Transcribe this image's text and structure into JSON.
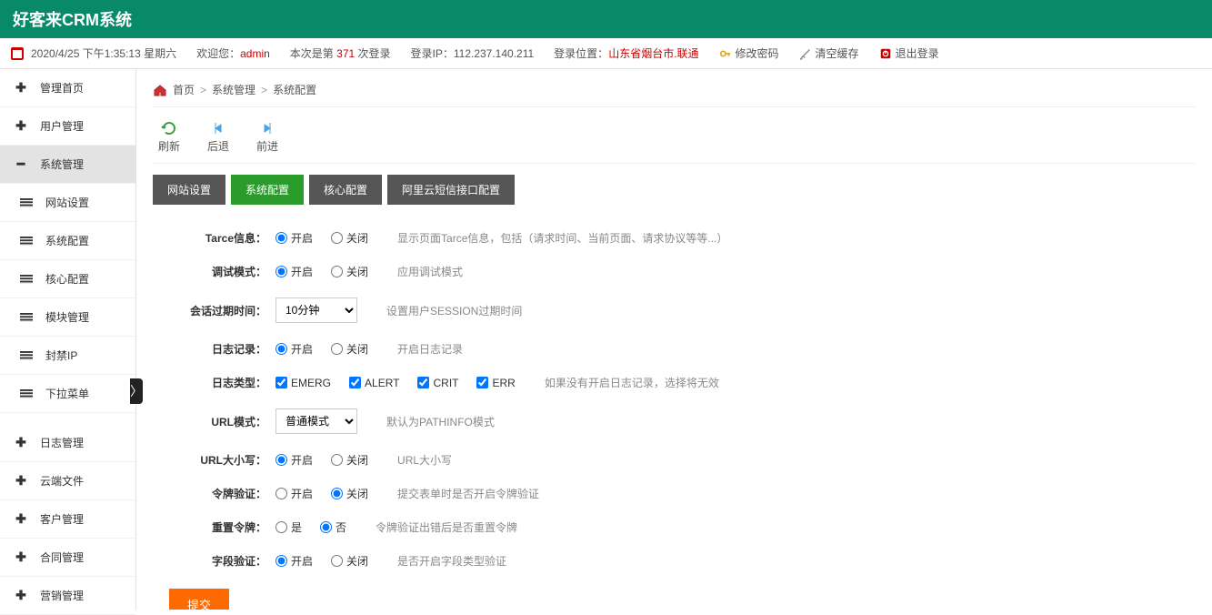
{
  "header": {
    "title": "好客来CRM系统"
  },
  "infobar": {
    "datetime": "2020/4/25 下午1:35:13 星期六",
    "welcome_prefix": "欢迎您：",
    "user": "admin",
    "login_count_prefix": "本次是第 ",
    "login_count": "371",
    "login_count_suffix": " 次登录",
    "login_ip_label": "登录IP：",
    "login_ip": "112.237.140.211",
    "login_loc_label": "登录位置：",
    "login_loc": "山东省烟台市.联通",
    "change_pw": "修改密码",
    "clear_cache": "清空缓存",
    "logout": "退出登录"
  },
  "sidebar": {
    "items": [
      {
        "label": "管理首页",
        "icon": "plus"
      },
      {
        "label": "用户管理",
        "icon": "plus"
      },
      {
        "label": "系统管理",
        "icon": "minus",
        "active": true
      },
      {
        "label": "网站设置",
        "icon": "lines",
        "sub": true
      },
      {
        "label": "系统配置",
        "icon": "lines",
        "sub": true
      },
      {
        "label": "核心配置",
        "icon": "lines",
        "sub": true
      },
      {
        "label": "模块管理",
        "icon": "lines",
        "sub": true
      },
      {
        "label": "封禁IP",
        "icon": "lines",
        "sub": true
      },
      {
        "label": "下拉菜单",
        "icon": "lines",
        "sub": true
      },
      {
        "label": "日志管理",
        "icon": "plus"
      },
      {
        "label": "云端文件",
        "icon": "plus"
      },
      {
        "label": "客户管理",
        "icon": "plus"
      },
      {
        "label": "合同管理",
        "icon": "plus"
      },
      {
        "label": "营销管理",
        "icon": "plus"
      }
    ]
  },
  "breadcrumb": {
    "home": "首页",
    "l1": "系统管理",
    "l2": "系统配置",
    "sep": ">"
  },
  "toolbar": {
    "refresh": "刷新",
    "back": "后退",
    "forward": "前进"
  },
  "tabs": [
    {
      "label": "网站设置"
    },
    {
      "label": "系统配置",
      "active": true
    },
    {
      "label": "核心配置"
    },
    {
      "label": "阿里云短信接口配置"
    }
  ],
  "form_labels": {
    "on": "开启",
    "off": "关闭",
    "yes": "是",
    "no": "否"
  },
  "rows": {
    "trace": {
      "label": "Tarce信息：",
      "desc": "显示页面Tarce信息，包括（请求时间、当前页面、请求协议等等...）",
      "val": "on"
    },
    "debug": {
      "label": "调试模式：",
      "desc": "应用调试模式",
      "val": "on"
    },
    "session": {
      "label": "会话过期时间：",
      "desc": "设置用户SESSION过期时间",
      "selected": "10分钟"
    },
    "log": {
      "label": "日志记录：",
      "desc": "开启日志记录",
      "val": "on"
    },
    "logtype": {
      "label": "日志类型：",
      "desc": "如果没有开启日志记录，选择将无效",
      "opts": [
        "EMERG",
        "ALERT",
        "CRIT",
        "ERR"
      ]
    },
    "urlmode": {
      "label": "URL模式：",
      "desc": "默认为PATHINFO模式",
      "selected": "普通模式"
    },
    "urlcase": {
      "label": "URL大小写：",
      "desc": "URL大小写",
      "val": "on"
    },
    "token": {
      "label": "令牌验证：",
      "desc": "提交表单时是否开启令牌验证",
      "val": "off"
    },
    "reset_token": {
      "label": "重置令牌：",
      "desc": "令牌验证出错后是否重置令牌",
      "val": "no"
    },
    "field": {
      "label": "字段验证：",
      "desc": "是否开启字段类型验证",
      "val": "on"
    }
  },
  "submit": "提交"
}
